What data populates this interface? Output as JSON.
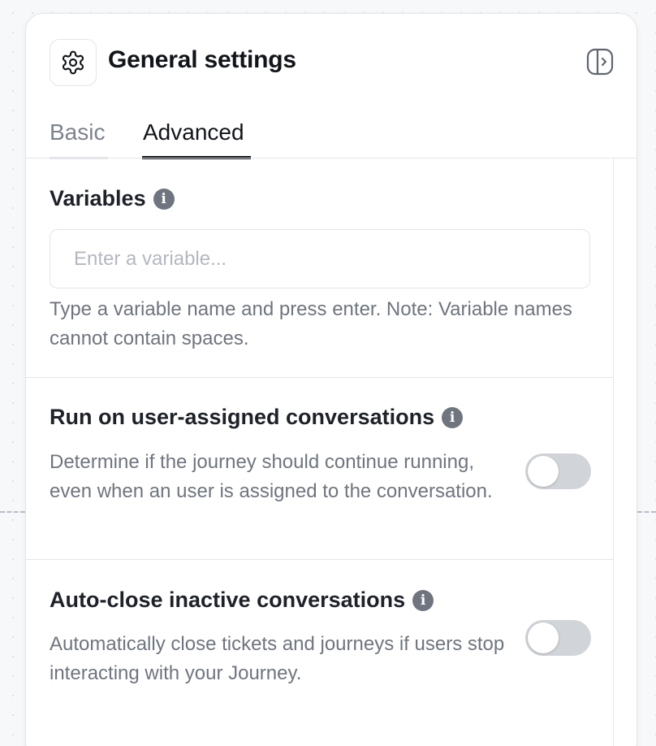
{
  "header": {
    "title": "General settings",
    "icon": "gear-icon",
    "collapse_icon": "panel-collapse-icon"
  },
  "tabs": [
    {
      "label": "Basic",
      "active": false
    },
    {
      "label": "Advanced",
      "active": true
    }
  ],
  "variables": {
    "title": "Variables",
    "info_icon": "info-icon",
    "input_value": "",
    "input_placeholder": "Enter a variable...",
    "help_text": "Type a variable name and press enter. Note: Variable names cannot contain spaces."
  },
  "run_on_assigned": {
    "title": "Run on user-assigned conversations",
    "info_icon": "info-icon",
    "description": "Determine if the journey should continue running, even when an user is assigned to the conversation.",
    "enabled": false
  },
  "auto_close": {
    "title": "Auto-close inactive conversations",
    "info_icon": "info-icon",
    "description": "Automatically close tickets and journeys if users stop interacting with your Journey.",
    "enabled": false
  },
  "colors": {
    "text_primary": "#111418",
    "text_muted": "#6f757e",
    "border": "#e3e5e8",
    "toggle_off": "#d1d4d8",
    "background": "#f7f8fa"
  }
}
